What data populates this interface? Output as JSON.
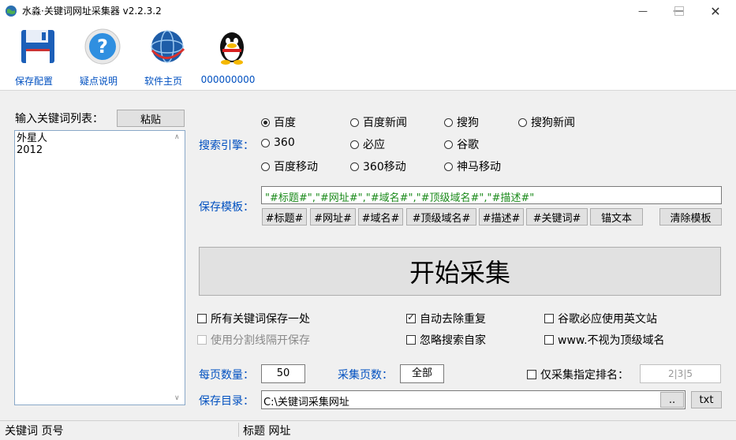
{
  "window": {
    "title": "水淼·关键词网址采集器  v2.2.3.2",
    "minimize_icon": "minimize-icon",
    "maximize_icon": "maximize-icon",
    "close_icon": "close-icon"
  },
  "toolbar": {
    "items": [
      {
        "label": "保存配置",
        "icon": "floppy-disk-icon"
      },
      {
        "label": "疑点说明",
        "icon": "help-icon"
      },
      {
        "label": "软件主页",
        "icon": "globe-icon"
      },
      {
        "label": "000000000",
        "icon": "qq-penguin-icon"
      }
    ]
  },
  "keywords": {
    "label": "输入关键词列表：",
    "paste_label": "粘贴",
    "lines": [
      "外星人",
      "2012"
    ]
  },
  "engine": {
    "label": "搜索引擎：",
    "options": [
      {
        "label": "百度",
        "selected": true
      },
      {
        "label": "百度新闻",
        "selected": false
      },
      {
        "label": "搜狗",
        "selected": false
      },
      {
        "label": "搜狗新闻",
        "selected": false
      },
      {
        "label": "360",
        "selected": false
      },
      {
        "label": "必应",
        "selected": false
      },
      {
        "label": "谷歌",
        "selected": false
      },
      {
        "label": "百度移动",
        "selected": false
      },
      {
        "label": "360移动",
        "selected": false
      },
      {
        "label": "神马移动",
        "selected": false
      }
    ]
  },
  "template": {
    "label": "保存模板：",
    "value": "\"#标题#\",\"#网址#\",\"#域名#\",\"#顶级域名#\",\"#描述#\"",
    "tags": [
      "#标题#",
      "#网址#",
      "#域名#",
      "#顶级域名#",
      "#描述#",
      "#关键词#",
      "锚文本"
    ],
    "clear_label": "清除模板"
  },
  "start_label": "开始采集",
  "options": {
    "save_all_one": {
      "label": "所有关键词保存一处",
      "checked": false
    },
    "split_line": {
      "label": "使用分割线隔开保存",
      "checked": false,
      "disabled": true
    },
    "auto_dedupe": {
      "label": "自动去除重复",
      "checked": true
    },
    "ignore_self": {
      "label": "忽略搜索自家",
      "checked": false
    },
    "google_bing_en": {
      "label": "谷歌必应使用英文站",
      "checked": false
    },
    "www_not_top": {
      "label": "www.不视为顶级域名",
      "checked": false
    }
  },
  "per_page": {
    "label": "每页数量：",
    "value": "50"
  },
  "pages": {
    "label": "采集页数：",
    "value": "全部"
  },
  "rank_only": {
    "label": "仅采集指定排名：",
    "checked": false,
    "placeholder": "2|3|5"
  },
  "save_dir": {
    "label": "保存目录：",
    "value": "C:\\关键词采集网址",
    "browse_label": "..",
    "format_label": "txt"
  },
  "status": {
    "left": "关键词  页号",
    "right": "标题  网址"
  }
}
